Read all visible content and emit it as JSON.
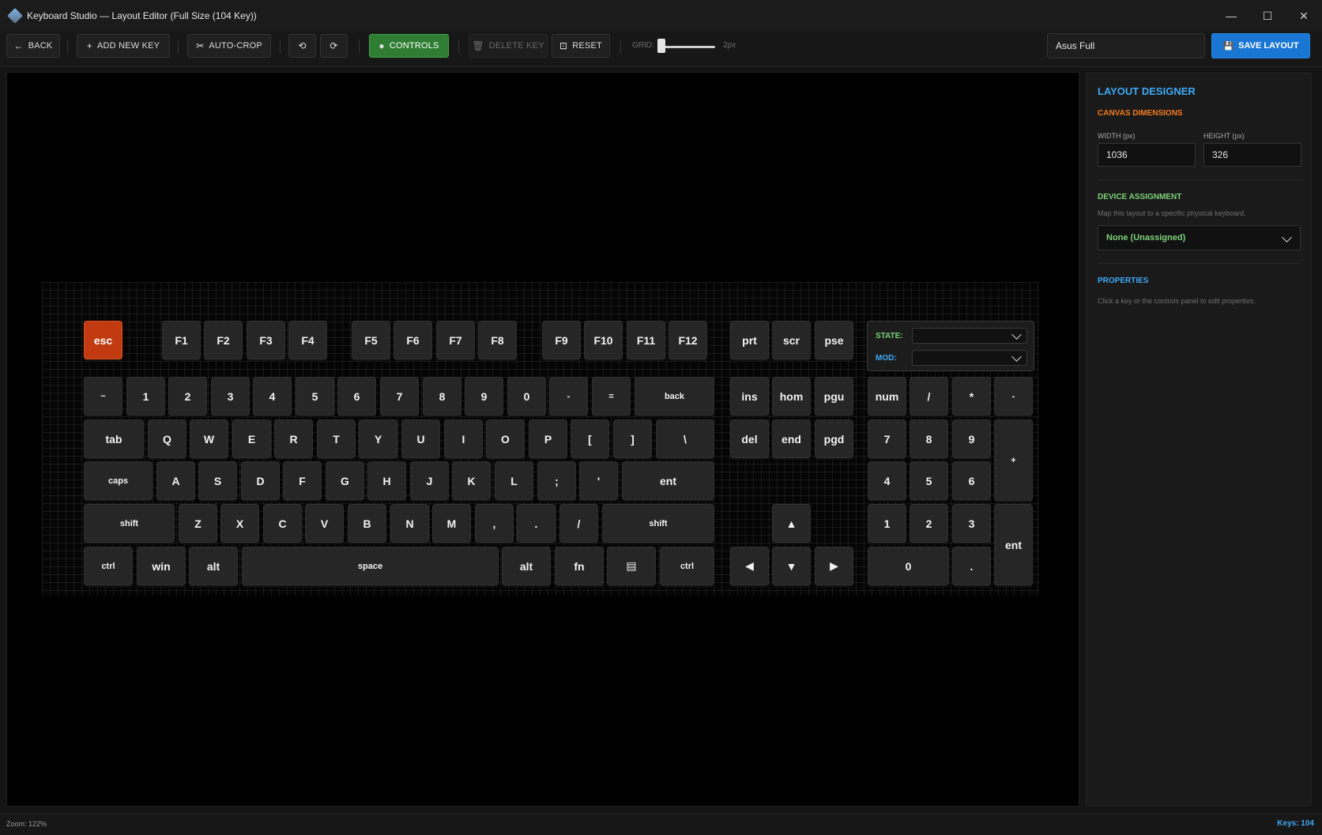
{
  "window": {
    "title": "Keyboard Studio — Layout Editor (Full Size (104 Key))",
    "minimize": "—",
    "maximize": "☐",
    "close": "✕"
  },
  "toolbar": {
    "back_label": "BACK",
    "add_key_label": "ADD NEW KEY",
    "autocrop_label": "AUTO-CROP",
    "rotate_left": "⟲",
    "rotate_right": "⟳",
    "controls_label": "CONTROLS",
    "delete_label": "DELETE KEY",
    "reset_label": "RESET",
    "grid_label": "GRID:",
    "grid_value": "2px",
    "layout_name": "Asus Full",
    "save_label": "SAVE LAYOUT"
  },
  "controls_panel": {
    "state_label": "STATE:",
    "mod_label": "MOD:",
    "state_color": "#7cd17a",
    "mod_color": "#3fa9f5"
  },
  "keys": [
    "esc",
    "F1",
    "F2",
    "F3",
    "F4",
    "F5",
    "F6",
    "F7",
    "F8",
    "F9",
    "F10",
    "F11",
    "F12",
    "prt",
    "scr",
    "pse",
    "~",
    "1",
    "2",
    "3",
    "4",
    "5",
    "6",
    "7",
    "8",
    "9",
    "0",
    "-",
    "=",
    "back",
    "ins",
    "hom",
    "pgu",
    "num",
    "/",
    "*",
    "-",
    "tab",
    "Q",
    "W",
    "E",
    "R",
    "T",
    "Y",
    "U",
    "I",
    "O",
    "P",
    "[",
    "]",
    "\\",
    "del",
    "end",
    "pgd",
    "7",
    "8",
    "9",
    "+",
    "caps",
    "A",
    "S",
    "D",
    "F",
    "G",
    "H",
    "J",
    "K",
    "L",
    ";",
    "'",
    "ent",
    "4",
    "5",
    "6",
    "shift",
    "Z",
    "X",
    "C",
    "V",
    "B",
    "N",
    "M",
    ",",
    ".",
    "/",
    "shift",
    "▲",
    "1",
    "2",
    "3",
    "ent",
    "ctrl",
    "win",
    "alt",
    "space",
    "alt",
    "fn",
    "▤",
    "ctrl",
    "◀",
    "▼",
    "▶",
    "0",
    "."
  ],
  "selected_key": "esc",
  "right_panel": {
    "title": "LAYOUT DESIGNER",
    "canvas_section": "CANVAS DIMENSIONS",
    "width_label": "WIDTH (px)",
    "height_label": "HEIGHT (px)",
    "width_value": "1036",
    "height_value": "326",
    "device_section": "DEVICE ASSIGNMENT",
    "device_hint": "Map this layout to a specific physical keyboard.",
    "device_value": "None (Unassigned)",
    "properties_section": "PROPERTIES",
    "properties_hint": "Click a key or the controls panel to edit properties."
  },
  "statusbar": {
    "zoom": "Zoom: 122%",
    "keys": "Keys: 104"
  },
  "colors": {
    "accent_blue": "#3fa9f5",
    "accent_orange": "#f57c1f",
    "accent_green": "#7cd17a",
    "selected_key": "#c23b10",
    "controls_button": "#2e7d32",
    "save_button": "#1976d2"
  }
}
